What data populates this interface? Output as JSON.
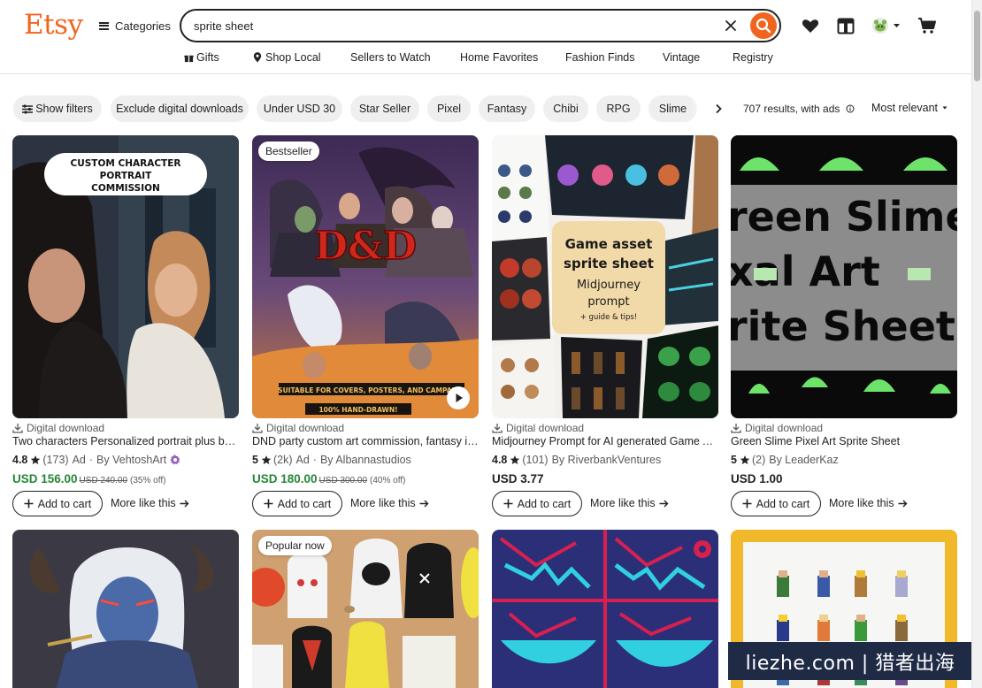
{
  "header": {
    "logo": "Etsy",
    "categories_label": "Categories",
    "search_value": "sprite sheet"
  },
  "subnav": {
    "items": [
      "Gifts",
      "Shop Local",
      "Sellers to Watch",
      "Home Favorites",
      "Fashion Finds",
      "Vintage",
      "Registry"
    ]
  },
  "filters": {
    "chips": [
      "Show filters",
      "Exclude digital downloads",
      "Under USD 30",
      "Star Seller",
      "Pixel",
      "Fantasy",
      "Chibi",
      "RPG",
      "Slime"
    ],
    "results": "707 results, with ads",
    "sort": "Most relevant"
  },
  "listings": [
    {
      "badge": "",
      "overlay_text": [
        "CUSTOM CHARACTER",
        "PORTRAIT",
        "COMMISSION"
      ],
      "type": "Digital download",
      "title": "Two characters Personalized portrait plus backgr...",
      "rating": "4.8",
      "reviews": "(173)",
      "ad": "Ad",
      "shop": "By VehtoshArt",
      "price": "USD 156.00",
      "original": "USD 240.00",
      "discount": "(35% off)",
      "add_label": "Add to cart",
      "more_label": "More like this"
    },
    {
      "badge": "Bestseller",
      "overlay_text": [
        "D&D",
        "SUITABLE FOR COVERS, POSTERS, AND CAMPAIGN",
        "100% HAND-DRAWN!"
      ],
      "type": "Digital download",
      "title": "DND party custom art commission, fantasy illustr...",
      "rating": "5",
      "reviews": "(2k)",
      "ad": "Ad",
      "shop": "By Albannastudios",
      "price": "USD 180.00",
      "original": "USD 300.00",
      "discount": "(40% off)",
      "add_label": "Add to cart",
      "more_label": "More like this"
    },
    {
      "badge": "",
      "overlay_text": [
        "Game asset",
        "sprite sheet",
        "Midjourney",
        "prompt",
        "+ guide & tips!"
      ],
      "type": "Digital download",
      "title": "Midjourney Prompt for AI generated Game Art Sp...",
      "rating": "4.8",
      "reviews": "(101)",
      "ad": "",
      "shop": "By RiverbankVentures",
      "price": "USD 3.77",
      "original": "",
      "discount": "",
      "add_label": "Add to cart",
      "more_label": "More like this"
    },
    {
      "badge": "",
      "overlay_text": [
        "reen Slime",
        "xal Art",
        "rite Sheet"
      ],
      "type": "Digital download",
      "title": "Green Slime Pixel Art Sprite Sheet",
      "rating": "5",
      "reviews": "(2)",
      "ad": "",
      "shop": "By LeaderKaz",
      "price": "USD 1.00",
      "original": "",
      "discount": "",
      "add_label": "Add to cart",
      "more_label": "More like this"
    },
    {
      "badge": ""
    },
    {
      "badge": "Popular now"
    },
    {
      "badge": ""
    },
    {
      "badge": ""
    }
  ],
  "watermark": "liezhe.com | 猎者出海",
  "colors": {
    "brand": "#f1641e",
    "sale_price": "#258635",
    "star_seller_badge": "#9560b8"
  }
}
